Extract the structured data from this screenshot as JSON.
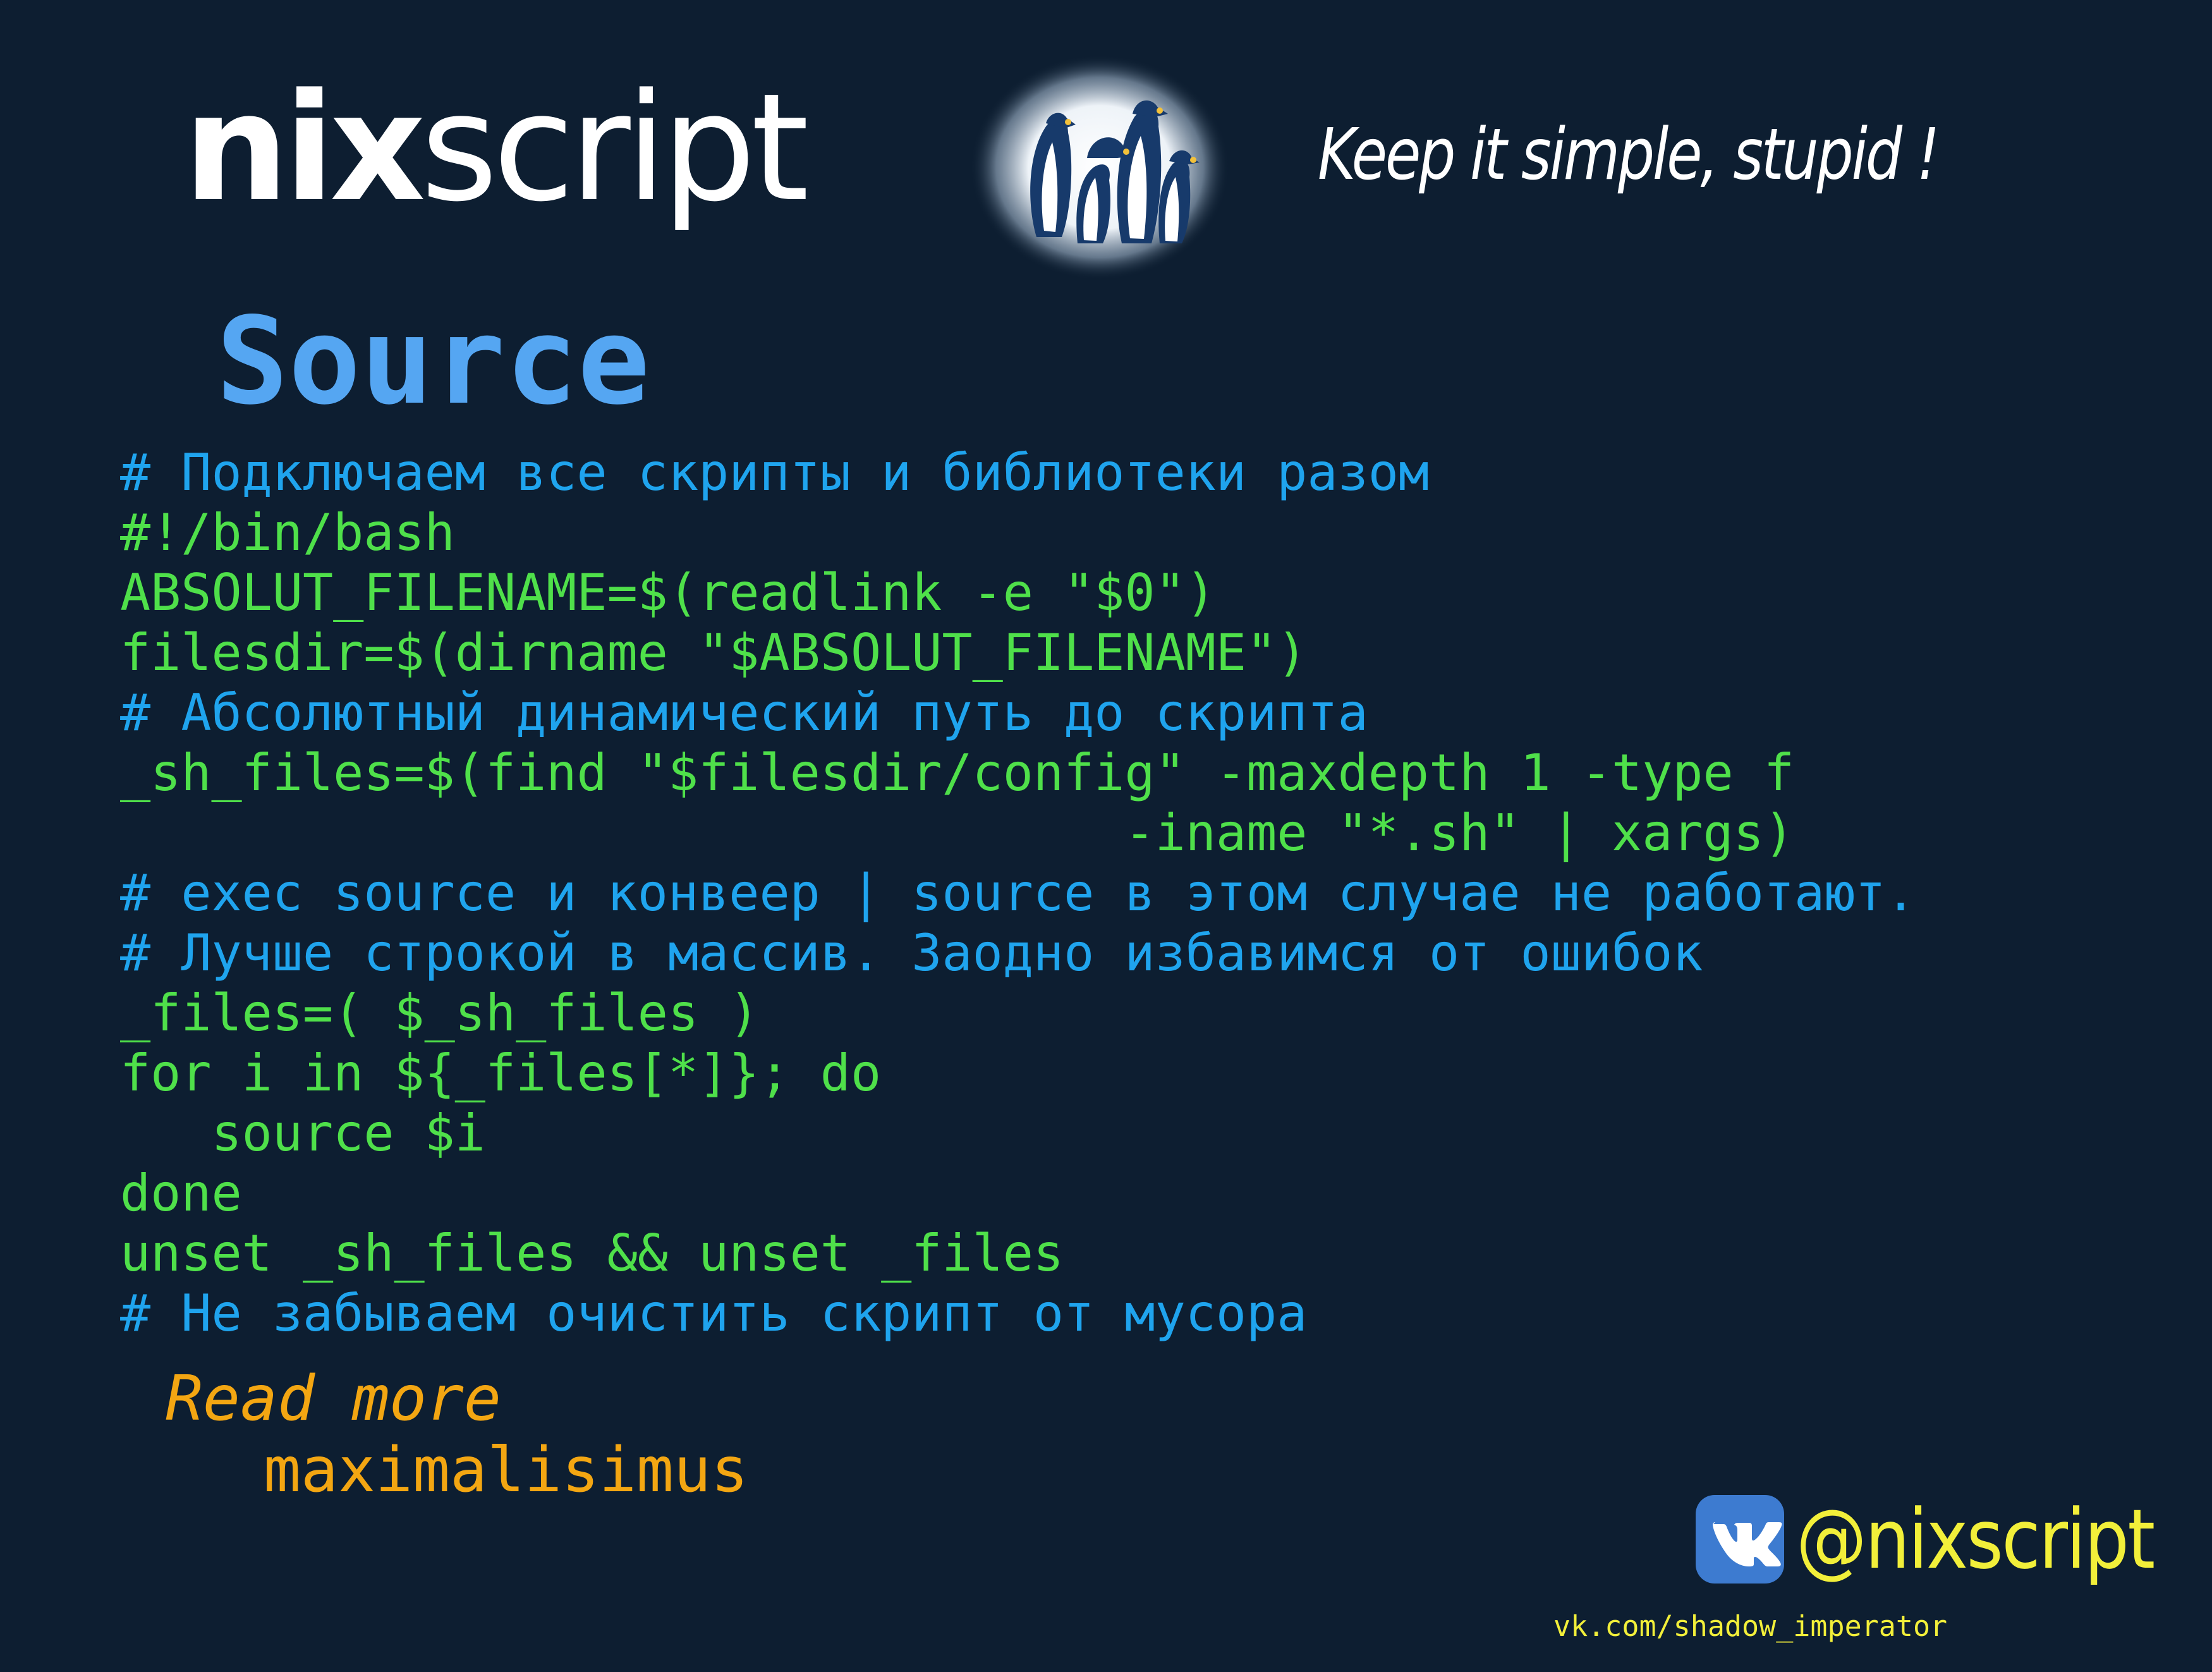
{
  "header": {
    "logo_text": "nixscript",
    "logo_bold_part": "nix",
    "logo_light_part": "script",
    "tagline": "Keep it simple, stupid !",
    "badge_icon": "penguins-icon"
  },
  "title": "Source",
  "code_lines": [
    {
      "type": "comment",
      "text": "# Подключаем все скрипты и библиотеки разом"
    },
    {
      "type": "cmd",
      "text": "#!/bin/bash"
    },
    {
      "type": "cmd",
      "text": "ABSOLUT_FILENAME=$(readlink -e \"$0\")"
    },
    {
      "type": "cmd",
      "text": "filesdir=$(dirname \"$ABSOLUT_FILENAME\")"
    },
    {
      "type": "comment",
      "text": "# Абсолютный динамический путь до скрипта"
    },
    {
      "type": "cmd",
      "text": "_sh_files=$(find \"$filesdir/config\" -maxdepth 1 -type f"
    },
    {
      "type": "cmd",
      "text": "                                 -iname \"*.sh\" | xargs)"
    },
    {
      "type": "comment",
      "text": "# exec source и конвеер | source в этом случае не работают."
    },
    {
      "type": "comment",
      "text": "# Лучше строкой в массив. Заодно избавимся от ошибок"
    },
    {
      "type": "cmd",
      "text": "_files=( $_sh_files )"
    },
    {
      "type": "cmd",
      "text": "for i in ${_files[*]}; do"
    },
    {
      "type": "cmd",
      "text": "   source $i"
    },
    {
      "type": "cmd",
      "text": "done"
    },
    {
      "type": "cmd",
      "text": "unset _sh_files && unset _files"
    },
    {
      "type": "comment",
      "text": "# Не забываем очистить скрипт от мусора"
    }
  ],
  "read_more": {
    "label": "Read more",
    "link_text": "maximalisimus"
  },
  "footer": {
    "social_icon": "vk-icon",
    "handle": "@nixscript",
    "profile_url": "vk.com/shadow_imperator"
  },
  "colors": {
    "background": "#0d1e31",
    "title": "#55a6f2",
    "comment": "#1fa4ee",
    "command": "#4fe04a",
    "read_more": "#f3a612",
    "footer": "#f2ef3a",
    "vk_blue": "#3d7bd0"
  }
}
